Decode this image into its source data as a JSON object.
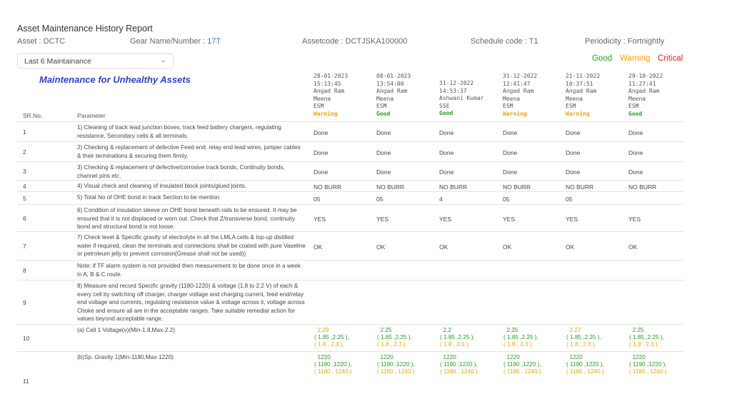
{
  "report_title": "Asset Maintenance History Report",
  "asset": "Asset : DCTC",
  "gear_prefix": "Gear Name/Number : ",
  "gear_value": "17T",
  "assetcode": "Assetcode : DCTJSKA100000",
  "schedule_code": "Schedule code : T1",
  "periodicity": "Periodicity : Fortnightly",
  "filter": {
    "selected": "Last 6 Maintainance"
  },
  "legend": {
    "good": "Good",
    "warning": "Warning",
    "critical": "Critical"
  },
  "colors": {
    "good": "#22a022",
    "warning": "#f0a500",
    "critical": "#e02020",
    "title_blue": "#2f3fd0",
    "link_blue": "#2b7bd6"
  },
  "section_title": "Maintenance for Unhealthy Assets",
  "headers": {
    "sr": "SR.No.",
    "parameter": "Parameter"
  },
  "maintenances": [
    {
      "date": "28-01-2023",
      "time": "15:13:45",
      "name": "Angad Ram",
      "name2": "Meena",
      "role": "ESM",
      "status": "Warning"
    },
    {
      "date": "08-01-2023",
      "time": "13:54:00",
      "name": "Angad Ram",
      "name2": "Meena",
      "role": "ESM",
      "status": "Good"
    },
    {
      "date": "31-12-2022",
      "time": "14:53:37",
      "name": "Ashwani Kumar",
      "name2": "",
      "role": "SSE",
      "status": "Good"
    },
    {
      "date": "31-12-2022",
      "time": "12:41:47",
      "name": "Angad Ram",
      "name2": "Meena",
      "role": "ESM",
      "status": "Warning"
    },
    {
      "date": "21-11-2022",
      "time": "10:37:51",
      "name": "Angad Ram",
      "name2": "Meena",
      "role": "ESM",
      "status": "Warning"
    },
    {
      "date": "29-10-2022",
      "time": "11:27:41",
      "name": "Angad Ram",
      "name2": "Meena",
      "role": "ESM",
      "status": "Good"
    }
  ],
  "rows": [
    {
      "sr": "1",
      "param": "1) Cleaning of track lead junction boxes, track feed battery chargers, regulating resistance, Secondary cells & all terminals.",
      "values": [
        "Done",
        "Done",
        "Done",
        "Done",
        "Done",
        "Done"
      ]
    },
    {
      "sr": "2",
      "param": "2) Checking & replacement of defective Feed end, relay end lead wires, jumper cables & their terminations & securing them firmly.",
      "values": [
        "Done",
        "Done",
        "Done",
        "Done",
        "Done",
        "Done"
      ]
    },
    {
      "sr": "3",
      "param": "3) Checking & replacement of defective/corrosive track bonds, Continuity bonds, channel pins etc.",
      "values": [
        "Done",
        "Done",
        "Done",
        "Done",
        "Done",
        "Done"
      ]
    },
    {
      "sr": "4",
      "param": "4) Visual check and cleaning of insulated block joints/glued joints.",
      "values": [
        "NO BURR",
        "NO BURR",
        "NO BURR",
        "NO BURR",
        "NO BURR",
        "NO BURR"
      ]
    },
    {
      "sr": "5",
      "param": "5) Total No of OHE bond in track Section to be mention",
      "values": [
        "05",
        "05",
        "4",
        "05",
        "05",
        ""
      ]
    },
    {
      "sr": "6",
      "param": "6) Condition of insulation sleeve on OHE bond beneath rails to be ensured. It may be ensured that it is not displaced or worn out. Check that Z/transverse bond, continuity bond and structural bond is not loose.",
      "values": [
        "YES",
        "YES",
        "YES",
        "YES",
        "YES",
        "YES"
      ]
    },
    {
      "sr": "7",
      "param": "7) Check level & Specific gravity of electrolyte in all the LMLA cells & top-up distilled water if required, clean the terminals and connections shall be coated with pure Vaseline or petroleum jelly to prevent corrosion(Grease shall not be used))",
      "values": [
        "OK",
        "OK",
        "OK",
        "OK",
        "OK",
        "OK"
      ]
    },
    {
      "sr": "8",
      "param": "Note: if TF alarm system is not provided then measurement to be done once in a week in A, B & C route.",
      "values": [
        "",
        "",
        "",
        "",
        "",
        ""
      ]
    },
    {
      "sr": "9",
      "param": "8) Measure and record Specific gravity (1180-1220) & voltage (1.8 to 2.2 V) of each & every cell by switching off charger, charger voltage and charging current, feed end/relay end voltage and currents, regulating resistance value & voltage across it, voltage across Choke and ensure all are in the acceptable ranges. Take suitable remedial action for values beyond acceptable range.",
      "values": [
        "",
        "",
        "",
        "",
        "",
        ""
      ]
    },
    {
      "sr": "10",
      "param": "(a) Cell 1 Voltage(v)(Min-1.8,Max-2.2)",
      "readings": [
        {
          "value": "2.29",
          "range_good": "( 1.85 ,2.25 ),",
          "range_warn": "( 1.8 , 2.3 ),",
          "status": "warning"
        },
        {
          "value": "2.25",
          "range_good": "( 1.85 ,2.25 ),",
          "range_warn": "( 1.8 , 2.3 ),",
          "status": "good"
        },
        {
          "value": "2.2",
          "range_good": "( 1.85 ,2.25 ),",
          "range_warn": "( 1.8 , 2.3 ),",
          "status": "good"
        },
        {
          "value": "2.25",
          "range_good": "( 1.85 ,2.25 ),",
          "range_warn": "( 1.8 , 2.3 ),",
          "status": "good"
        },
        {
          "value": "2.27",
          "range_good": "( 1.85 ,2.25 ),",
          "range_warn": "( 1.8 , 2.3 ),",
          "status": "warning"
        },
        {
          "value": "2.25",
          "range_good": "( 1.85 ,2.25 ),",
          "range_warn": "( 1.8 , 2.3 ),",
          "status": "good"
        }
      ]
    },
    {
      "sr": "11",
      "param": "(b)Sp. Gravity 1(Min-1180,Max-1220)",
      "readings": [
        {
          "value": "1220",
          "range_good": "( 1190 ,1220 ),",
          "range_warn": "( 1180 , 1240 )",
          "status": "good"
        },
        {
          "value": "1220",
          "range_good": "( 1190 ,1220 ),",
          "range_warn": "( 1180 , 1240 )",
          "status": "good"
        },
        {
          "value": "1220",
          "range_good": "( 1190 ,1220 ),",
          "range_warn": "( 1180 , 1240 )",
          "status": "good"
        },
        {
          "value": "1220",
          "range_good": "( 1190 ,1220 ),",
          "range_warn": "( 1180 , 1240 )",
          "status": "good"
        },
        {
          "value": "1220",
          "range_good": "( 1190 ,1220 ),",
          "range_warn": "( 1180 , 1240 )",
          "status": "good"
        },
        {
          "value": "1220",
          "range_good": "( 1190 ,1220 ),",
          "range_warn": "( 1180 , 1240 )",
          "status": "good"
        }
      ]
    }
  ]
}
